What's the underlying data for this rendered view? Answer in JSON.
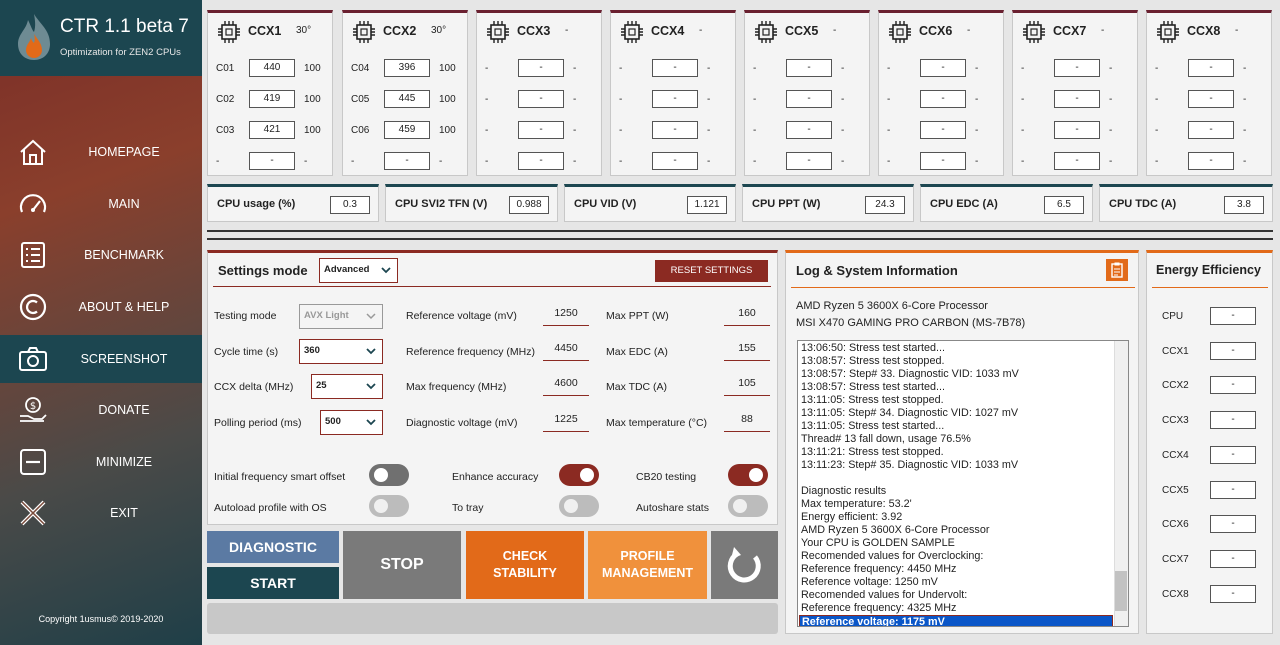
{
  "app": {
    "title": "CTR 1.1 beta 7",
    "subtitle": "Optimization for ZEN2 CPUs",
    "copyright": "Copyright 1usmus© 2019-2020",
    "accent": "#8b2a22",
    "teal": "#1c4650",
    "orange": "#e26a19"
  },
  "nav": [
    {
      "label": "HOMEPAGE",
      "icon": "home-icon"
    },
    {
      "label": "MAIN",
      "icon": "speedometer-icon"
    },
    {
      "label": "BENCHMARK",
      "icon": "list-icon"
    },
    {
      "label": "ABOUT & HELP",
      "icon": "copyright-icon"
    },
    {
      "label": "SCREENSHOT",
      "icon": "camera-icon",
      "active": true
    },
    {
      "label": "DONATE",
      "icon": "money-hand-icon"
    },
    {
      "label": "MINIMIZE",
      "icon": "minimize-icon"
    },
    {
      "label": "EXIT",
      "icon": "close-icon"
    }
  ],
  "ccx": [
    {
      "name": "CCX1",
      "temp": "30°",
      "cores": [
        {
          "label": "C01",
          "value": "440",
          "max": "100"
        },
        {
          "label": "C02",
          "value": "419",
          "max": "100"
        },
        {
          "label": "C03",
          "value": "421",
          "max": "100"
        },
        {
          "label": "-",
          "value": "-",
          "max": "-"
        }
      ]
    },
    {
      "name": "CCX2",
      "temp": "30°",
      "cores": [
        {
          "label": "C04",
          "value": "396",
          "max": "100"
        },
        {
          "label": "C05",
          "value": "445",
          "max": "100"
        },
        {
          "label": "C06",
          "value": "459",
          "max": "100"
        },
        {
          "label": "-",
          "value": "-",
          "max": "-"
        }
      ]
    },
    {
      "name": "CCX3",
      "temp": "-",
      "cores": [
        {
          "label": "-",
          "value": "-",
          "max": "-"
        },
        {
          "label": "-",
          "value": "-",
          "max": "-"
        },
        {
          "label": "-",
          "value": "-",
          "max": "-"
        },
        {
          "label": "-",
          "value": "-",
          "max": "-"
        }
      ]
    },
    {
      "name": "CCX4",
      "temp": "-",
      "cores": [
        {
          "label": "-",
          "value": "-",
          "max": "-"
        },
        {
          "label": "-",
          "value": "-",
          "max": "-"
        },
        {
          "label": "-",
          "value": "-",
          "max": "-"
        },
        {
          "label": "-",
          "value": "-",
          "max": "-"
        }
      ]
    },
    {
      "name": "CCX5",
      "temp": "-",
      "cores": [
        {
          "label": "-",
          "value": "-",
          "max": "-"
        },
        {
          "label": "-",
          "value": "-",
          "max": "-"
        },
        {
          "label": "-",
          "value": "-",
          "max": "-"
        },
        {
          "label": "-",
          "value": "-",
          "max": "-"
        }
      ]
    },
    {
      "name": "CCX6",
      "temp": "-",
      "cores": [
        {
          "label": "-",
          "value": "-",
          "max": "-"
        },
        {
          "label": "-",
          "value": "-",
          "max": "-"
        },
        {
          "label": "-",
          "value": "-",
          "max": "-"
        },
        {
          "label": "-",
          "value": "-",
          "max": "-"
        }
      ]
    },
    {
      "name": "CCX7",
      "temp": "-",
      "cores": [
        {
          "label": "-",
          "value": "-",
          "max": "-"
        },
        {
          "label": "-",
          "value": "-",
          "max": "-"
        },
        {
          "label": "-",
          "value": "-",
          "max": "-"
        },
        {
          "label": "-",
          "value": "-",
          "max": "-"
        }
      ]
    },
    {
      "name": "CCX8",
      "temp": "-",
      "cores": [
        {
          "label": "-",
          "value": "-",
          "max": "-"
        },
        {
          "label": "-",
          "value": "-",
          "max": "-"
        },
        {
          "label": "-",
          "value": "-",
          "max": "-"
        },
        {
          "label": "-",
          "value": "-",
          "max": "-"
        }
      ]
    }
  ],
  "metrics": [
    {
      "label": "CPU usage (%)",
      "value": "0.3"
    },
    {
      "label": "CPU SVI2 TFN (V)",
      "value": "0.988"
    },
    {
      "label": "CPU VID (V)",
      "value": "1.121"
    },
    {
      "label": "CPU PPT (W)",
      "value": "24.3"
    },
    {
      "label": "CPU EDC (A)",
      "value": "6.5"
    },
    {
      "label": "CPU TDC (A)",
      "value": "3.8"
    }
  ],
  "settings": {
    "title": "Settings mode",
    "mode": "Advanced",
    "reset_label": "RESET SETTINGS",
    "testing_mode_label": "Testing mode",
    "testing_mode_value": "AVX Light",
    "cycle_time_label": "Cycle time (s)",
    "cycle_time_value": "360",
    "ccx_delta_label": "CCX delta (MHz)",
    "ccx_delta_value": "25",
    "polling_label": "Polling period (ms)",
    "polling_value": "500",
    "ref_voltage_label": "Reference voltage (mV)",
    "ref_voltage_value": "1250",
    "ref_freq_label": "Reference frequency (MHz)",
    "ref_freq_value": "4450",
    "max_freq_label": "Max frequency (MHz)",
    "max_freq_value": "4600",
    "diag_voltage_label": "Diagnostic voltage (mV)",
    "diag_voltage_value": "1225",
    "max_ppt_label": "Max PPT (W)",
    "max_ppt_value": "160",
    "max_edc_label": "Max EDC (A)",
    "max_edc_value": "155",
    "max_tdc_label": "Max TDC (A)",
    "max_tdc_value": "105",
    "max_temp_label": "Max temperature (°C)",
    "max_temp_value": "88",
    "toggles": {
      "smart_offset": "Initial frequency smart offset",
      "enhance_accuracy": "Enhance accuracy",
      "cb20": "CB20 testing",
      "autoload": "Autoload profile with OS",
      "to_tray": "To tray",
      "autoshare": "Autoshare stats"
    }
  },
  "buttons": {
    "diagnostic": "DIAGNOSTIC",
    "start": "START",
    "stop": "STOP",
    "check_stability": "CHECK STABILITY",
    "profile_management": "PROFILE MANAGEMENT"
  },
  "log": {
    "title": "Log & System Information",
    "cpu": "AMD Ryzen 5 3600X 6-Core Processor",
    "board": "MSI X470 GAMING PRO CARBON (MS-7B78)",
    "lines": [
      "13:06:50: Stress test started...",
      "13:08:57: Stress test stopped.",
      "13:08:57: Step# 33. Diagnostic VID: 1033 mV",
      "13:08:57: Stress test started...",
      "13:11:05: Stress test stopped.",
      "13:11:05: Step# 34. Diagnostic VID: 1027 mV",
      "13:11:05: Stress test started...",
      "Thread# 13 fall down, usage 76.5%",
      "13:11:21: Stress test stopped.",
      "13:11:23: Step# 35. Diagnostic VID: 1033 mV",
      "",
      "Diagnostic results",
      "Max temperature: 53.2'",
      "Energy efficient: 3.92",
      "AMD Ryzen 5 3600X 6-Core Processor",
      "Your CPU is GOLDEN SAMPLE",
      "Recomended values for Overclocking:",
      "Reference frequency: 4450 MHz",
      "Reference voltage: 1250 mV",
      "Recomended values for Undervolt:",
      "Reference frequency: 4325 MHz",
      "Reference voltage: 1175 mV"
    ]
  },
  "energy": {
    "title": "Energy Efficiency",
    "rows": [
      {
        "label": "CPU",
        "value": "-"
      },
      {
        "label": "CCX1",
        "value": "-"
      },
      {
        "label": "CCX2",
        "value": "-"
      },
      {
        "label": "CCX3",
        "value": "-"
      },
      {
        "label": "CCX4",
        "value": "-"
      },
      {
        "label": "CCX5",
        "value": "-"
      },
      {
        "label": "CCX6",
        "value": "-"
      },
      {
        "label": "CCX7",
        "value": "-"
      },
      {
        "label": "CCX8",
        "value": "-"
      }
    ]
  }
}
